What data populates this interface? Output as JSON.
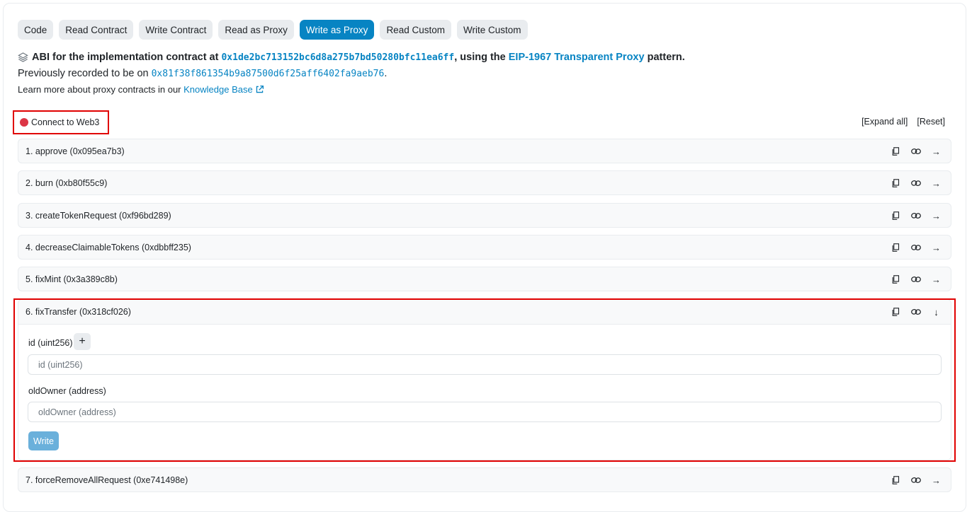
{
  "tabs": [
    "Code",
    "Read Contract",
    "Write Contract",
    "Read as Proxy",
    "Write as Proxy",
    "Read Custom",
    "Write Custom"
  ],
  "active_tab": "Write as Proxy",
  "info": {
    "line1_prefix": "ABI for the implementation contract at ",
    "impl_address": "0x1de2bc713152bc6d8a275b7bd50280bfc11ea6ff",
    "line1_middle": ", using the ",
    "proxy_pattern": "EIP-1967 Transparent Proxy",
    "line1_suffix": " pattern.",
    "line2_prefix": "Previously recorded to be on ",
    "prev_address": "0x81f38f861354b9a87500d6f25aff6402fa9aeb76",
    "line2_suffix": ".",
    "line3_prefix": "Learn more about proxy contracts in our ",
    "knowledge_base": "Knowledge Base"
  },
  "connect_label": "Connect to Web3",
  "expand_all": "[Expand all]",
  "reset": "[Reset]",
  "functions": [
    {
      "label": "1. approve (0x095ea7b3)",
      "expanded": false
    },
    {
      "label": "2. burn (0xb80f55c9)",
      "expanded": false
    },
    {
      "label": "3. createTokenRequest (0xf96bd289)",
      "expanded": false
    },
    {
      "label": "4. decreaseClaimableTokens (0xdbbff235)",
      "expanded": false
    },
    {
      "label": "5. fixMint (0x3a389c8b)",
      "expanded": false
    },
    {
      "label": "6. fixTransfer (0x318cf026)",
      "expanded": true
    },
    {
      "label": "7. forceRemoveAllRequest (0xe741498e)",
      "expanded": false
    }
  ],
  "fixTransfer": {
    "param1_label": "id (uint256)",
    "param1_placeholder": "id (uint256)",
    "plus": "+",
    "param2_label": "oldOwner (address)",
    "param2_placeholder": "oldOwner (address)",
    "write_label": "Write"
  },
  "colors": {
    "accent": "#0784c3",
    "highlight": "#e00000",
    "disconnected": "#dc3545"
  }
}
